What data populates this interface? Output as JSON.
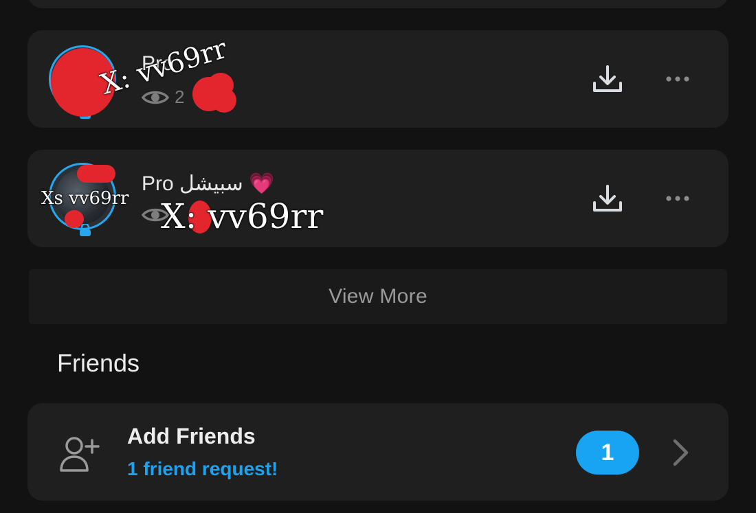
{
  "stories": [
    {
      "title": "Pro",
      "view_count": "2",
      "watermark_text": "X: vv69rr"
    },
    {
      "title": "Pro سبيشل 💗",
      "view_count": "",
      "avatar_overlay_text": "Xs vv69rr",
      "watermark_text": "X: vv69rr"
    }
  ],
  "view_more_label": "View More",
  "friends_section_title": "Friends",
  "add_friends": {
    "title": "Add Friends",
    "subtitle": "1 friend request!",
    "badge_count": "1"
  },
  "icons": {
    "download": "download-icon",
    "more": "more-horizontal-icon",
    "eye": "eye-icon",
    "lock": "lock-icon",
    "add_friend": "add-friend-icon",
    "chevron": "chevron-right-icon"
  },
  "colors": {
    "background": "#121212",
    "card": "#1f1f1f",
    "accent_blue": "#1ba2f0",
    "redaction_red": "#e3262e"
  }
}
